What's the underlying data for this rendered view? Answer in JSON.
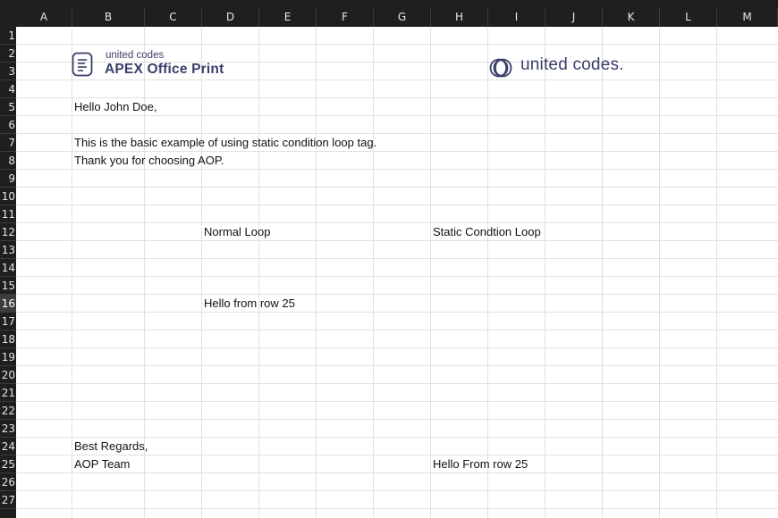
{
  "columns": [
    "A",
    "B",
    "C",
    "D",
    "E",
    "F",
    "G",
    "H",
    "I",
    "J",
    "K",
    "L",
    "M"
  ],
  "rows": [
    "1",
    "2",
    "3",
    "4",
    "5",
    "6",
    "7",
    "8",
    "9",
    "10",
    "11",
    "12",
    "13",
    "14",
    "15",
    "16",
    "17",
    "18",
    "19",
    "20",
    "21",
    "22",
    "23",
    "24",
    "25",
    "26",
    "27"
  ],
  "selected_row": "16",
  "logos": {
    "aop_small": "united codes",
    "aop_big": "APEX Office Print",
    "uc_text": "united codes."
  },
  "cells": {
    "b5": "Hello John Doe,",
    "b7": "This is the basic example of using static condition loop tag.",
    "b8": "Thank you for choosing AOP.",
    "d12": "Normal Loop",
    "h12": "Static Condtion Loop",
    "d16": "Hello from row 25",
    "b24": "Best Regards,",
    "b25": "AOP Team",
    "h25": "Hello From row 25"
  },
  "colors": {
    "header_bg": "#1f1f1f",
    "gridline": "#e1e1e1",
    "logo_navy": "#3a3f6a"
  }
}
